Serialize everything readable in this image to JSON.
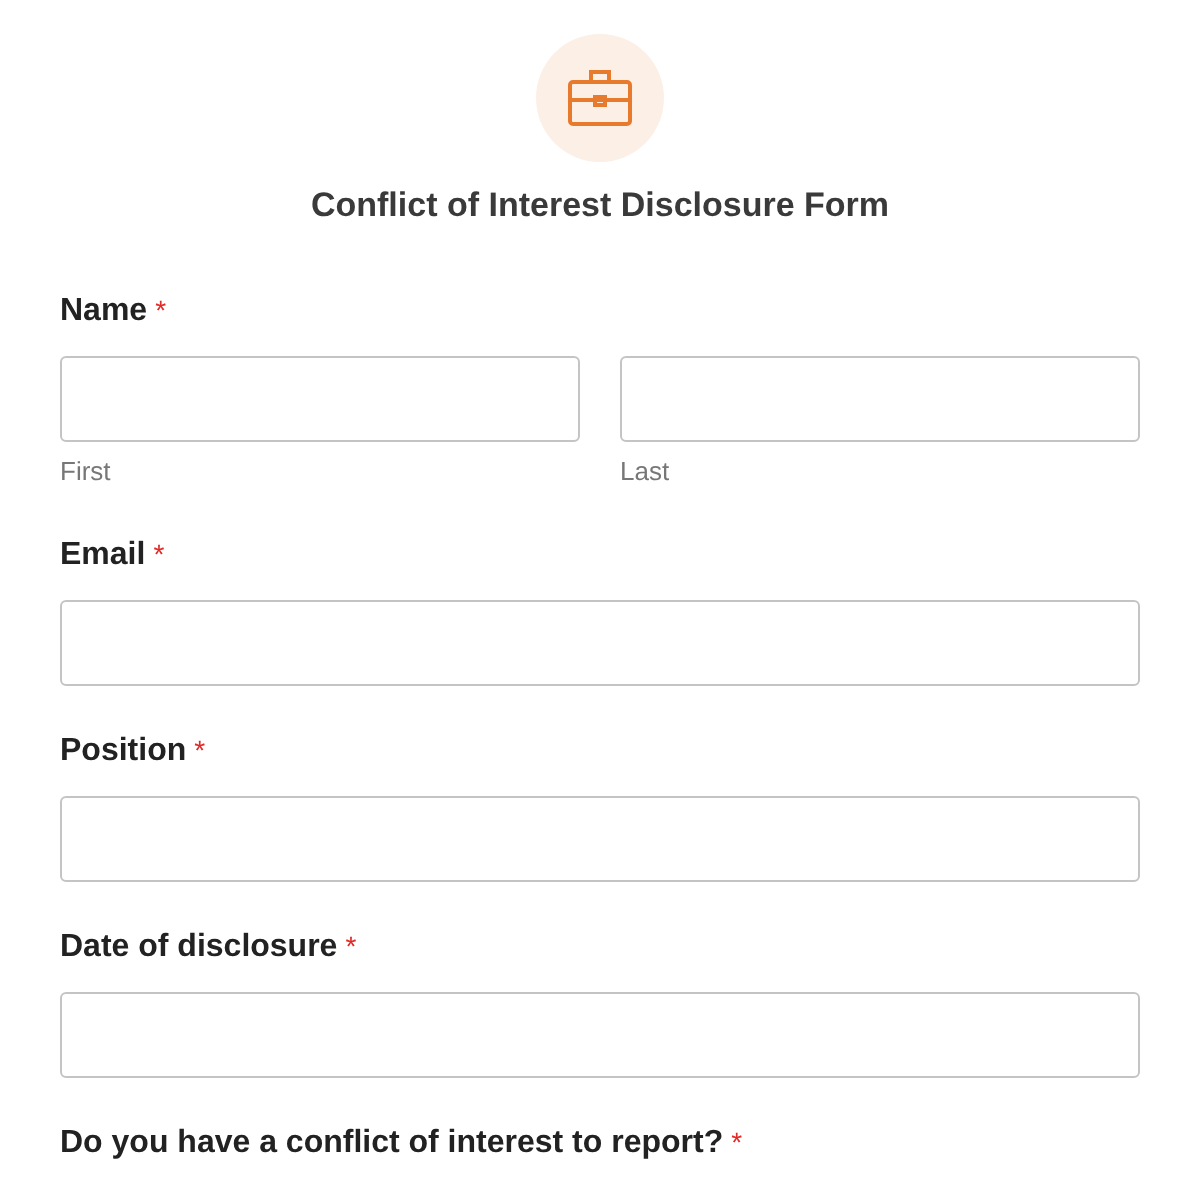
{
  "form": {
    "title": "Conflict of Interest Disclosure Form"
  },
  "fields": [
    {
      "kind": "name",
      "label": "Name",
      "asterisk": "*",
      "sublabels": [
        "First",
        "Last"
      ]
    },
    {
      "kind": "text",
      "label": "Email",
      "asterisk": "*"
    },
    {
      "kind": "text",
      "label": "Position",
      "asterisk": "*"
    },
    {
      "kind": "text",
      "label": "Date of disclosure",
      "asterisk": "*"
    },
    {
      "kind": "question",
      "label": "Do you have a conflict of interest to report?",
      "asterisk": "*"
    }
  ]
}
